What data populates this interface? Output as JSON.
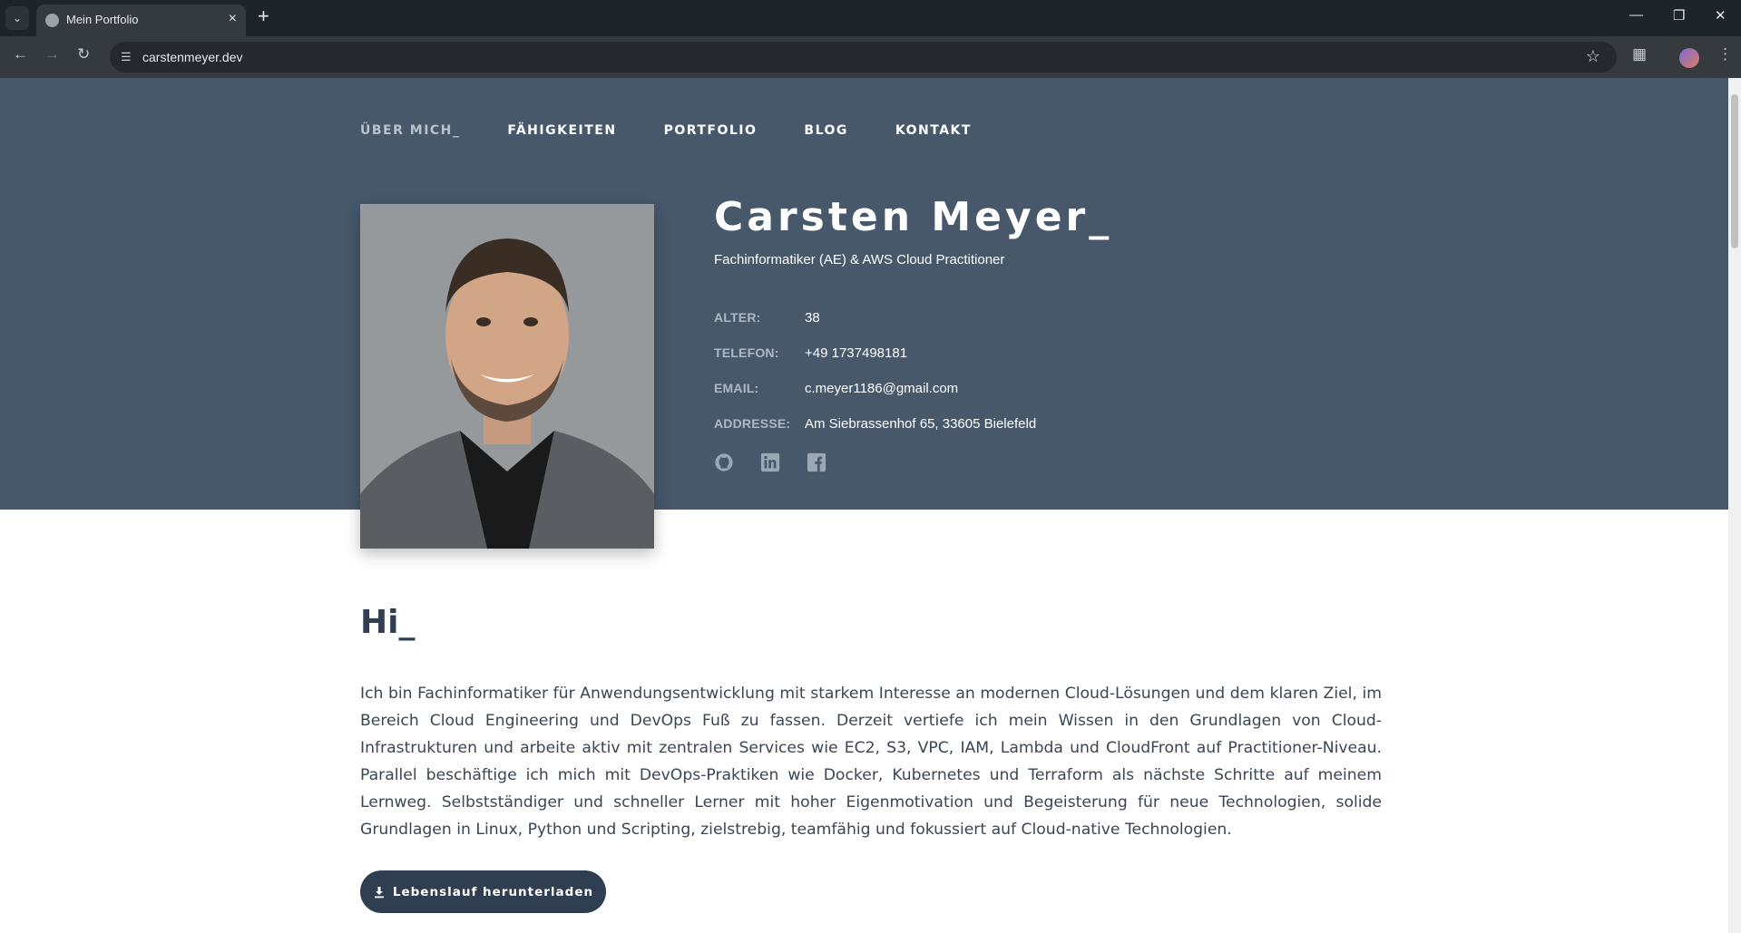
{
  "browser": {
    "tab_title": "Mein Portfolio",
    "url": "carstenmeyer.dev",
    "new_tab_label": "+",
    "tab_close_label": "×"
  },
  "nav": {
    "items": [
      {
        "label": "ÜBER MICH_",
        "active": true
      },
      {
        "label": "FÄHIGKEITEN",
        "active": false
      },
      {
        "label": "PORTFOLIO",
        "active": false
      },
      {
        "label": "BLOG",
        "active": false
      },
      {
        "label": "KONTAKT",
        "active": false
      }
    ]
  },
  "profile": {
    "name": "Carsten Meyer_",
    "subtitle": "Fachinformatiker (AE) & AWS Cloud Practitioner",
    "info": [
      {
        "label": "ALTER:",
        "value": "38"
      },
      {
        "label": "TELEFON:",
        "value": "+49 1737498181"
      },
      {
        "label": "EMAIL:",
        "value": "c.meyer1186@gmail.com"
      },
      {
        "label": "ADDRESSE:",
        "value": "Am Siebrassenhof 65, 33605 Bielefeld"
      }
    ],
    "socials": [
      "github-icon",
      "linkedin-icon",
      "facebook-icon"
    ]
  },
  "about": {
    "heading": "Hi_",
    "text": "Ich bin Fachinformatiker für Anwendungsentwicklung mit starkem Interesse an modernen Cloud-Lösungen und dem klaren Ziel, im Bereich Cloud Engineering und DevOps Fuß zu fassen. Derzeit vertiefe ich mein Wissen in den Grundlagen von Cloud-Infrastrukturen und arbeite aktiv mit zentralen Services wie EC2, S3, VPC, IAM, Lambda und CloudFront auf Practitioner-Niveau. Parallel beschäftige ich mich mit DevOps-Praktiken wie Docker, Kubernetes und Terraform als nächste Schritte auf meinem Lernweg. Selbstständiger und schneller Lerner mit hoher Eigenmotivation und Begeisterung für neue Technologien, solide Grundlagen in Linux, Python und Scripting, zielstrebig, teamfähig und fokussiert auf Cloud-native Technologien.",
    "cv_button": "Lebenslauf herunterladen"
  },
  "colors": {
    "hero_bg": "#47586b",
    "accent_dark": "#2f3e50"
  }
}
